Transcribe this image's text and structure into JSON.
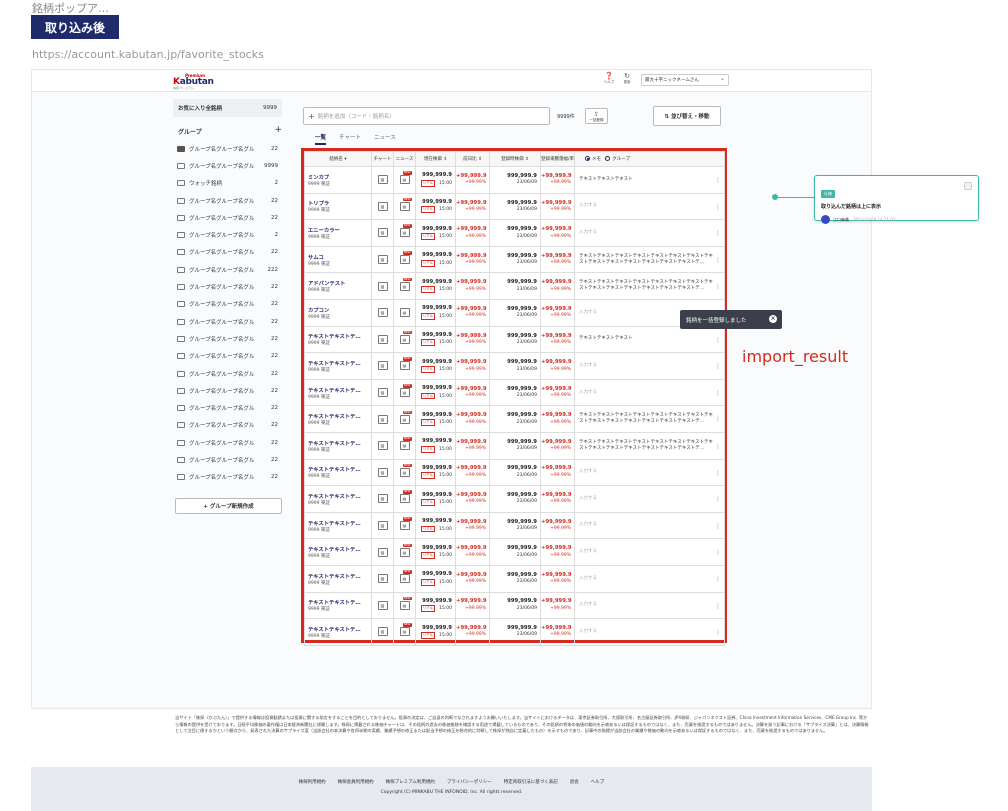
{
  "doc": {
    "title": "銘柄ポップア…",
    "badge": "取り込み後",
    "url": "https://account.kabutan.jp/favorite_stocks"
  },
  "header": {
    "logo_top": "Premium",
    "logo_k": "K",
    "logo_rest": "abutan",
    "logo_sub": "株探プレミアム",
    "help_label": "ヘルプ",
    "update_label": "更新",
    "user_name": "最大十字ニックネームさん"
  },
  "sidebar": {
    "fav_label": "お気に入り全銘柄",
    "fav_count": "9999",
    "group_title": "グループ",
    "add_label": "+",
    "items": [
      {
        "name": "グループ名グループ名グル",
        "count": "22",
        "filled": true
      },
      {
        "name": "グループ名グループ名グル",
        "count": "9999",
        "filled": false
      },
      {
        "name": "ウォッチ銘柄",
        "count": "2",
        "filled": false
      },
      {
        "name": "グループ名グループ名グル",
        "count": "22",
        "filled": false
      },
      {
        "name": "グループ名グループ名グル",
        "count": "22",
        "filled": false
      },
      {
        "name": "グループ名グループ名グル",
        "count": "2",
        "filled": false
      },
      {
        "name": "グループ名グループ名グル",
        "count": "22",
        "filled": false
      },
      {
        "name": "グループ名グループ名グル",
        "count": "222",
        "filled": false
      },
      {
        "name": "グループ名グループ名グル",
        "count": "22",
        "filled": false
      },
      {
        "name": "グループ名グループ名グル",
        "count": "22",
        "filled": false
      },
      {
        "name": "グループ名グループ名グル",
        "count": "22",
        "filled": false
      },
      {
        "name": "グループ名グループ名グル",
        "count": "22",
        "filled": false
      },
      {
        "name": "グループ名グループ名グル",
        "count": "22",
        "filled": false
      },
      {
        "name": "グループ名グループ名グル",
        "count": "22",
        "filled": false
      },
      {
        "name": "グループ名グループ名グル",
        "count": "22",
        "filled": false
      },
      {
        "name": "グループ名グループ名グル",
        "count": "22",
        "filled": false
      },
      {
        "name": "グループ名グループ名グル",
        "count": "22",
        "filled": false
      },
      {
        "name": "グループ名グループ名グル",
        "count": "22",
        "filled": false
      },
      {
        "name": "グループ名グループ名グル",
        "count": "22",
        "filled": false
      },
      {
        "name": "グループ名グループ名グル",
        "count": "22",
        "filled": false
      }
    ],
    "new_group": "+ グループ新規作成"
  },
  "toolbar": {
    "search_placeholder": "銘柄を追加（コード・銘柄名）",
    "count": "9999件",
    "bulk_label": "一括登録",
    "sort_label": "⇅ 並び替え・移動"
  },
  "tabs": [
    "一覧",
    "チャート",
    "ニュース"
  ],
  "table": {
    "headers": {
      "name": "銘柄名 ▾",
      "chart": "チャート",
      "news": "ニュース",
      "price": "現在株価 ⇕",
      "change": "前日比 ⇕",
      "reg_price": "登録時株価 ⇕",
      "reg_change": "登録来騰落幅/率",
      "memo": "メモ",
      "group": "グループ"
    },
    "rows": [
      {
        "name": "ミンカブ",
        "code": "9999 東証",
        "news_new": "NEW",
        "price": "999,999.9",
        "rt": "リアル",
        "time": "15:00",
        "chg": "+99,999.9",
        "chg_pct": "+99.99%",
        "reg": "999,999.9",
        "reg_date": "23/06/09",
        "rchg": "+99,999.9",
        "rchg_pct": "+99.99%",
        "memo": "テキストテキストテキスト",
        "is_ph": false
      },
      {
        "name": "トリプラ",
        "code": "9999 東証",
        "news_new": "NEW",
        "price": "999,999.9",
        "rt": "リアル",
        "time": "15:00",
        "chg": "+99,999.9",
        "chg_pct": "+99.99%",
        "reg": "999,999.9",
        "reg_date": "23/06/09",
        "rchg": "+99,999.9",
        "rchg_pct": "+99.99%",
        "memo": "入力する",
        "is_ph": true
      },
      {
        "name": "エニーカラー",
        "code": "9999 東証",
        "news_new": "NEW",
        "price": "999,999.9",
        "rt": "リアル",
        "time": "15:00",
        "chg": "+99,999.9",
        "chg_pct": "+99.99%",
        "reg": "999,999.9",
        "reg_date": "23/06/09",
        "rchg": "+99,999.9",
        "rchg_pct": "+99.99%",
        "memo": "入力する",
        "is_ph": true
      },
      {
        "name": "サムコ",
        "code": "9999 東証",
        "news_new": "NEW",
        "price": "999,999.9",
        "rt": "リアル",
        "time": "15:00",
        "chg": "+99,999.9",
        "chg_pct": "+99.99%",
        "reg": "999,999.9",
        "reg_date": "23/06/09",
        "rchg": "+99,999.9",
        "rchg_pct": "+99.99%",
        "memo": "テキストテキストテキストテキストテキストテキストテキストテキストテキストテキストテキストテキストテキストテキストテ…",
        "is_ph": false
      },
      {
        "name": "アドバンテスト",
        "code": "9999 東証",
        "news_new": "NEW",
        "price": "999,999.9",
        "rt": "リアル",
        "time": "15:00",
        "chg": "+99,999.9",
        "chg_pct": "+99.99%",
        "reg": "999,999.9",
        "reg_date": "23/06/09",
        "rchg": "+99,999.9",
        "rchg_pct": "+99.99%",
        "memo": "テキストテキストテキストテキストテキストテキストテキストテキストテキストテキストテキストテキストテキストテキストテ…",
        "is_ph": false
      },
      {
        "name": "カプコン",
        "code": "9999 東証",
        "news_new": "",
        "price": "999,999.9",
        "rt": "リアル",
        "time": "15:00",
        "chg": "+99,999.9",
        "chg_pct": "+99.99%",
        "reg": "999,999.9",
        "reg_date": "23/06/09",
        "rchg": "+99,999.9",
        "rchg_pct": "+99.99%",
        "memo": "入力する",
        "is_ph": true
      },
      {
        "name": "テキストテキストテ…",
        "code": "9999 東証",
        "news_new": "NEW",
        "price": "999,999.9",
        "rt": "リアル",
        "time": "15:00",
        "chg": "+99,999.9",
        "chg_pct": "+99.99%",
        "reg": "999,999.9",
        "reg_date": "23/06/09",
        "rchg": "+99,999.9",
        "rchg_pct": "+99.99%",
        "memo": "テキストテキストテキスト",
        "is_ph": false
      },
      {
        "name": "テキストテキストテ…",
        "code": "9999 東証",
        "news_new": "NEW",
        "price": "999,999.9",
        "rt": "リアル",
        "time": "15:00",
        "chg": "+99,999.9",
        "chg_pct": "+99.99%",
        "reg": "999,999.9",
        "reg_date": "23/06/09",
        "rchg": "+99,999.9",
        "rchg_pct": "+99.99%",
        "memo": "入力する",
        "is_ph": true
      },
      {
        "name": "テキストテキストテ…",
        "code": "9999 東証",
        "news_new": "NEW",
        "price": "999,999.9",
        "rt": "リアル",
        "time": "15:00",
        "chg": "+99,999.9",
        "chg_pct": "+99.99%",
        "reg": "999,999.9",
        "reg_date": "23/06/09",
        "rchg": "+99,999.9",
        "rchg_pct": "+99.99%",
        "memo": "入力する",
        "is_ph": true
      },
      {
        "name": "テキストテキストテ…",
        "code": "9999 東証",
        "news_new": "NEW",
        "price": "999,999.9",
        "rt": "リアル",
        "time": "15:00",
        "chg": "+99,999.9",
        "chg_pct": "+99.99%",
        "reg": "999,999.9",
        "reg_date": "23/06/09",
        "rchg": "+99,999.9",
        "rchg_pct": "+99.99%",
        "memo": "テキストテキストテキストテキストテキストテキストテキストテキストテキストテキストテキストテキストテキストテキストテ…",
        "is_ph": false
      },
      {
        "name": "テキストテキストテ…",
        "code": "9999 東証",
        "news_new": "NEW",
        "price": "999,999.9",
        "rt": "リアル",
        "time": "15:00",
        "chg": "+99,999.9",
        "chg_pct": "+99.99%",
        "reg": "999,999.9",
        "reg_date": "23/06/09",
        "rchg": "+99,999.9",
        "rchg_pct": "+99.99%",
        "memo": "テキストテキストテキストテキストテキストテキストテキストテキストテキストテキストテキストテキストテキストテキストテ…",
        "is_ph": false
      },
      {
        "name": "テキストテキストテ…",
        "code": "9999 東証",
        "news_new": "NEW",
        "price": "999,999.9",
        "rt": "リアル",
        "time": "15:00",
        "chg": "+99,999.9",
        "chg_pct": "+99.99%",
        "reg": "999,999.9",
        "reg_date": "23/06/09",
        "rchg": "+99,999.9",
        "rchg_pct": "+99.99%",
        "memo": "入力する",
        "is_ph": true
      },
      {
        "name": "テキストテキストテ…",
        "code": "9999 東証",
        "news_new": "NEW",
        "price": "999,999.9",
        "rt": "リアル",
        "time": "15:00",
        "chg": "+99,999.9",
        "chg_pct": "+99.99%",
        "reg": "999,999.9",
        "reg_date": "23/06/09",
        "rchg": "+99,999.9",
        "rchg_pct": "+99.99%",
        "memo": "入力する",
        "is_ph": true
      },
      {
        "name": "テキストテキストテ…",
        "code": "9999 東証",
        "news_new": "NEW",
        "price": "999,999.9",
        "rt": "リアル",
        "time": "15:00",
        "chg": "+99,999.9",
        "chg_pct": "+99.99%",
        "reg": "999,999.9",
        "reg_date": "23/06/09",
        "rchg": "+99,999.9",
        "rchg_pct": "+99.99%",
        "memo": "入力する",
        "is_ph": true
      },
      {
        "name": "テキストテキストテ…",
        "code": "9999 東証",
        "news_new": "NEW",
        "price": "999,999.9",
        "rt": "リアル",
        "time": "15:00",
        "chg": "+99,999.9",
        "chg_pct": "+99.99%",
        "reg": "999,999.9",
        "reg_date": "23/06/09",
        "rchg": "+99,999.9",
        "rchg_pct": "+99.99%",
        "memo": "入力する",
        "is_ph": true
      },
      {
        "name": "テキストテキストテ…",
        "code": "9999 東証",
        "news_new": "NEW",
        "price": "999,999.9",
        "rt": "リアル",
        "time": "15:00",
        "chg": "+99,999.9",
        "chg_pct": "+99.99%",
        "reg": "999,999.9",
        "reg_date": "23/06/09",
        "rchg": "+99,999.9",
        "rchg_pct": "+99.99%",
        "memo": "入力する",
        "is_ph": true
      },
      {
        "name": "テキストテキストテ…",
        "code": "9999 東証",
        "news_new": "NEW",
        "price": "999,999.9",
        "rt": "リアル",
        "time": "15:00",
        "chg": "+99,999.9",
        "chg_pct": "+99.99%",
        "reg": "999,999.9",
        "reg_date": "23/06/09",
        "rchg": "+99,999.9",
        "rchg_pct": "+99.99%",
        "memo": "入力する",
        "is_ph": true
      },
      {
        "name": "テキストテキストテ…",
        "code": "9999 東証",
        "news_new": "NEW",
        "price": "999,999.9",
        "rt": "リアル",
        "time": "15:00",
        "chg": "+99,999.9",
        "chg_pct": "+99.99%",
        "reg": "999,999.9",
        "reg_date": "23/06/09",
        "rchg": "+99,999.9",
        "rchg_pct": "+99.99%",
        "memo": "入力する",
        "is_ph": true
      }
    ]
  },
  "toast": {
    "text": "銘柄を一括登録しました",
    "close": "×"
  },
  "annotation": {
    "label": "import_result"
  },
  "note": {
    "tag": "仕様",
    "text": "取り込んだ銘柄は上に表示",
    "author": "江口麻美",
    "date": "2023-10-04 14:21:03"
  },
  "disclaimer": "当サイト「株探（かぶたん）」で提供する情報は投資勧誘または投資に関する助言をすることを目的としておりません。投資の決定は、ご自身の判断でなされますようお願いいたします。当サイトにおけるデータは、東京証券取引所、大阪取引所、名古屋証券取引所、JPX総研、ジャパンネクスト証券、China Investment Information Services、CME Group Inc. 等から情報の提供を受けております。日経平均株価の著作権は日本経済新聞社に帰属します。株探に掲載される株価チャートは、その銘柄の過去の株価推移を確認する用途で掲載しているものであり、その銘柄の将来の価値の動向を示唆あるいは保証するものではなく、また、売買を推奨するものではありません。決算を扱う記事における「サプライズ決算」とは、決算情報として注目に値するかという観点から、発表された決算のサプライズ度（当該会社の本決算や各四半期の実績、業績予想の修正または配当予想の修正を総合的に判断して株探が独自に定義したもの）を示すものであり、記事中の指標が当該会社の業績や株価の動向を示唆あるいは保証するものではなく、また、売買を推奨するものではありません。",
  "footer": {
    "links": [
      "株探利用規約",
      "株探会員利用規約",
      "株探プレミアム利用規約",
      "プライバシーポリシー",
      "特定商取引法に基づく表記",
      "退会",
      "ヘルプ"
    ],
    "copyright": "Copyright (C) MINKABU THE INFONOID, Inc. All rights reserved."
  }
}
